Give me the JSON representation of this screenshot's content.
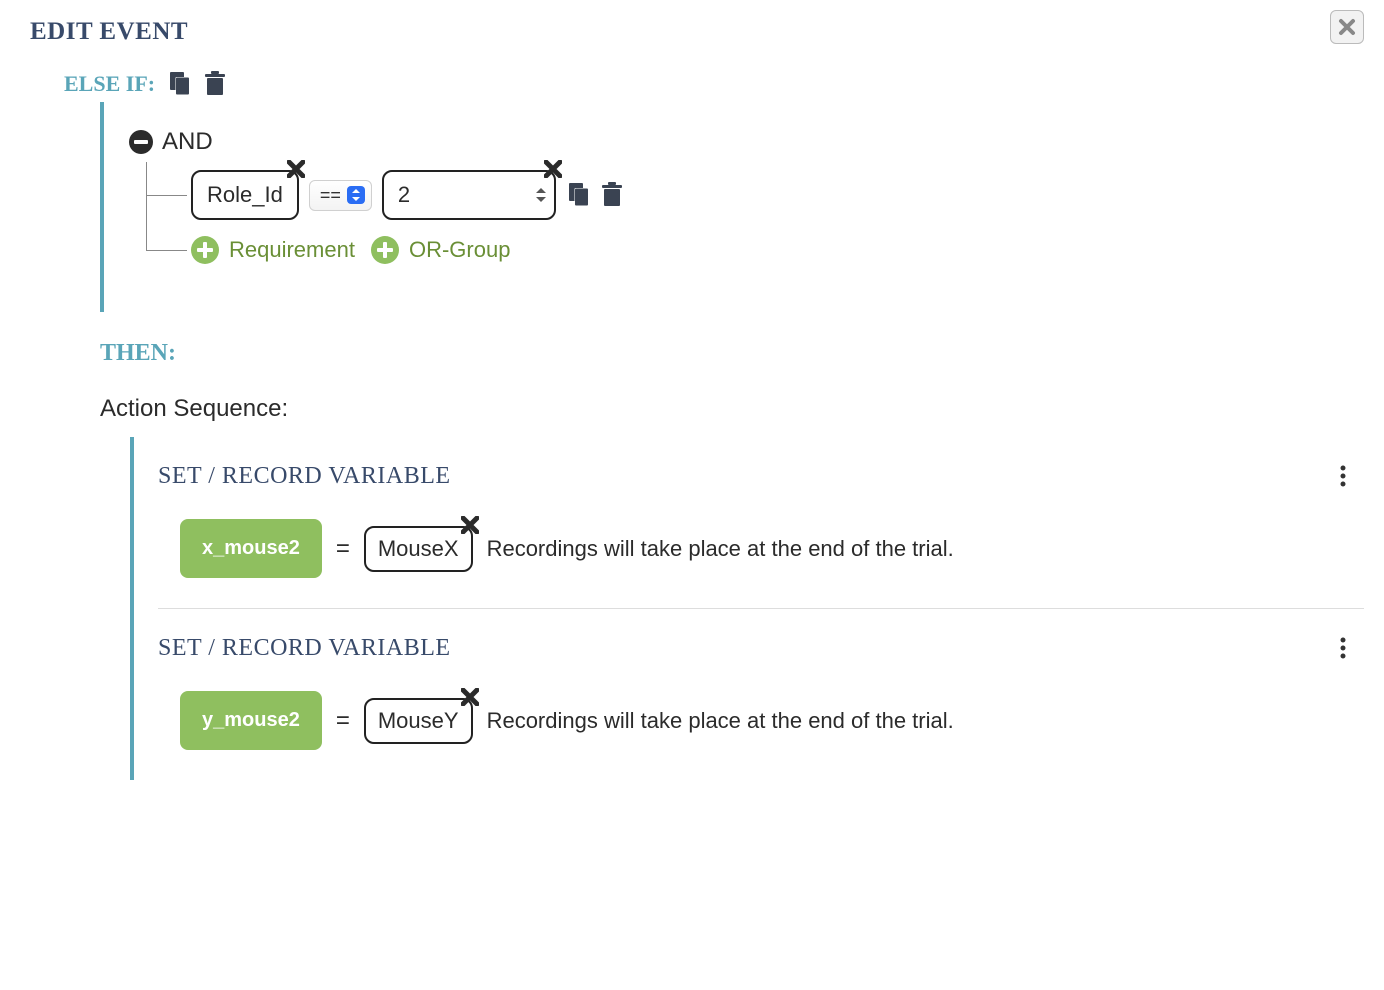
{
  "title": "EDIT EVENT",
  "elseif": {
    "label": "ELSE IF:",
    "logic": "AND",
    "condition": {
      "variable": "Role_Id",
      "operator": "==",
      "value": "2"
    },
    "add_requirement": "Requirement",
    "add_orgroup": "OR-Group"
  },
  "then": {
    "label": "THEN:",
    "sequence_label": "Action Sequence:",
    "actions": [
      {
        "title": "SET / RECORD VARIABLE",
        "var_name": "x_mouse2",
        "equals": "=",
        "value": "MouseX",
        "note": "Recordings will take place at the end of the trial."
      },
      {
        "title": "SET / RECORD VARIABLE",
        "var_name": "y_mouse2",
        "equals": "=",
        "value": "MouseY",
        "note": "Recordings will take place at the end of the trial."
      }
    ]
  }
}
